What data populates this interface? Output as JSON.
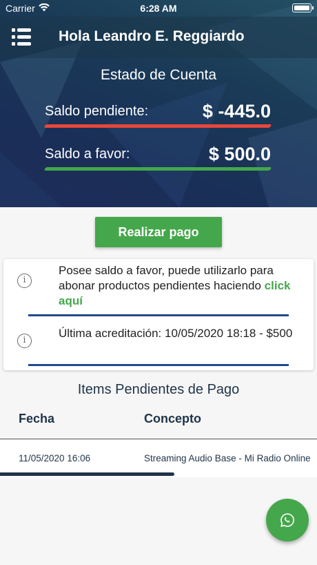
{
  "status_bar": {
    "carrier": "Carrier",
    "time": "6:28 AM"
  },
  "header": {
    "greeting": "Hola Leandro E. Reggiardo"
  },
  "account": {
    "title": "Estado de Cuenta",
    "pending_label": "Saldo pendiente:",
    "pending_amount": "$ -445.0",
    "credit_label": "Saldo a favor:",
    "credit_amount": "$ 500.0"
  },
  "pay_button": {
    "label": "Realizar pago"
  },
  "info": {
    "items": [
      {
        "text": "Posee saldo a favor, puede utilizarlo para abonar productos pendientes haciendo ",
        "link": "click aquí"
      },
      {
        "text": "Última acreditación: 10/05/2020 18:18 - $500"
      }
    ]
  },
  "pending_items": {
    "title": "Items Pendientes de Pago",
    "columns": [
      "Fecha",
      "Concepto"
    ],
    "rows": [
      {
        "fecha": "11/05/2020 16:06",
        "concepto": "Streaming Audio Base - Mi Radio Online"
      }
    ]
  },
  "colors": {
    "accent_green": "#45a74b",
    "pending_red": "#e8473a",
    "divider_blue": "#1f4a8a",
    "header_dark": "#1a3b57"
  },
  "icons": {
    "menu": "list-menu-icon",
    "info": "info-circle-icon",
    "whatsapp": "whatsapp-icon",
    "wifi": "wifi-icon",
    "battery": "battery-icon"
  }
}
